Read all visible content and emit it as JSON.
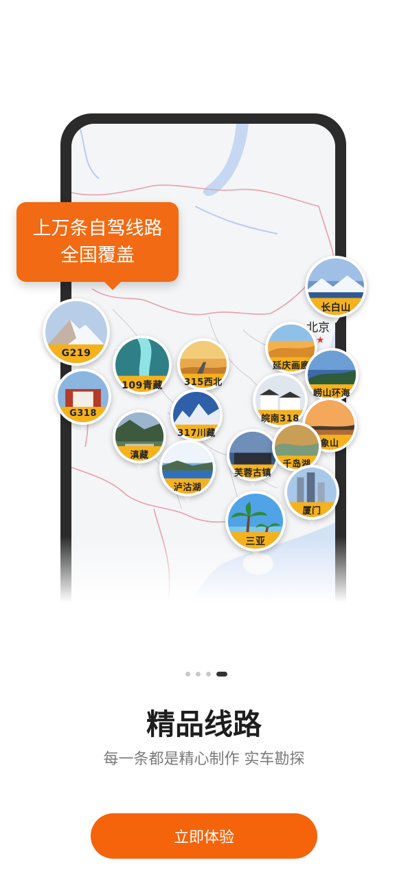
{
  "callout": {
    "line1": "上万条自驾线路",
    "line2": "全国覆盖"
  },
  "map": {
    "city_label": "北京",
    "city_marker": "★"
  },
  "routes": [
    {
      "label": "长白山",
      "scene": "snow-lake"
    },
    {
      "label": "G219",
      "scene": "snow-peak"
    },
    {
      "label": "109青藏",
      "scene": "turquoise-river"
    },
    {
      "label": "315西北",
      "scene": "desert-road"
    },
    {
      "label": "延庆画廊",
      "scene": "desert-dunes"
    },
    {
      "label": "崂山环海",
      "scene": "coastal-hills"
    },
    {
      "label": "G318",
      "scene": "palace"
    },
    {
      "label": "皖南318",
      "scene": "village"
    },
    {
      "label": "317川藏",
      "scene": "mountain-range"
    },
    {
      "label": "象山",
      "scene": "sunset-sea"
    },
    {
      "label": "滇藏",
      "scene": "valley-town"
    },
    {
      "label": "芙蓉古镇",
      "scene": "old-town"
    },
    {
      "label": "千岛湖",
      "scene": "islands-lake"
    },
    {
      "label": "泸沽湖",
      "scene": "lake"
    },
    {
      "label": "厦门",
      "scene": "city-towers"
    },
    {
      "label": "三亚",
      "scene": "palm-beach"
    }
  ],
  "pager": {
    "count": 4,
    "active": 3
  },
  "title": "精品线路",
  "subtitle": "每一条都是精心制作 实车勘探",
  "cta_label": "立即体验",
  "colors": {
    "accent": "#f5630b",
    "callout": "#f26a13",
    "label_band": "#f6b21c"
  }
}
